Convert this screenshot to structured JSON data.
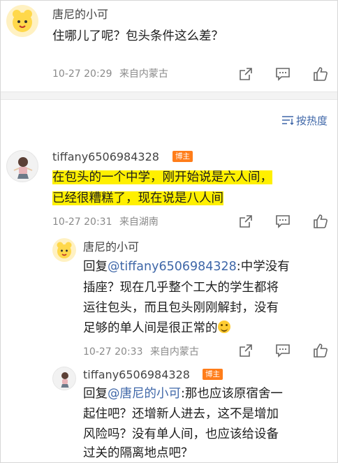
{
  "comment1": {
    "username": "唐尼的小可",
    "text": "住哪儿了呢？包头条件这么差？",
    "time": "10-27 20:29",
    "source": "来自内蒙古"
  },
  "sort": {
    "label": "按热度"
  },
  "comment2": {
    "username": "tiffany6506984328",
    "badge": "博主",
    "line1": "在包头的一个中学，刚开始说是六人间，",
    "line2": "已经很糟糕了，现在说是八人间",
    "time": "10-27 20:31",
    "source": "来自湖南"
  },
  "reply1": {
    "username": "唐尼的小可",
    "reply_prefix": "回复",
    "mention": "@tiffany6506984328",
    "line1_rest": ":中学没有",
    "line2": "插座？现在几乎整个工大的学生都将",
    "line3": "运往包头，而且包头刚刚解封，没有",
    "line4": "足够的单人间是很正常的",
    "time": "10-27 20:33",
    "source": "来自内蒙古"
  },
  "reply2": {
    "username": "tiffany6506984328",
    "badge": "博主",
    "reply_prefix": "回复",
    "mention": "@唐尼的小可",
    "line1_rest": ":那也应该原宿舍一",
    "line2": "起住吧？还增新人进去，这不是增加",
    "line3": "风险吗？没有单人间，也应该给设备",
    "line4": "过关的隔离地点吧？"
  },
  "colors": {
    "link": "#3f67a8",
    "highlight": "#fff000",
    "badge": "#ff7d1a",
    "meta": "#8a8a8a"
  },
  "icons": [
    "share-icon",
    "comment-icon",
    "like-icon",
    "sort-icon",
    "laugh-emoji-icon"
  ]
}
